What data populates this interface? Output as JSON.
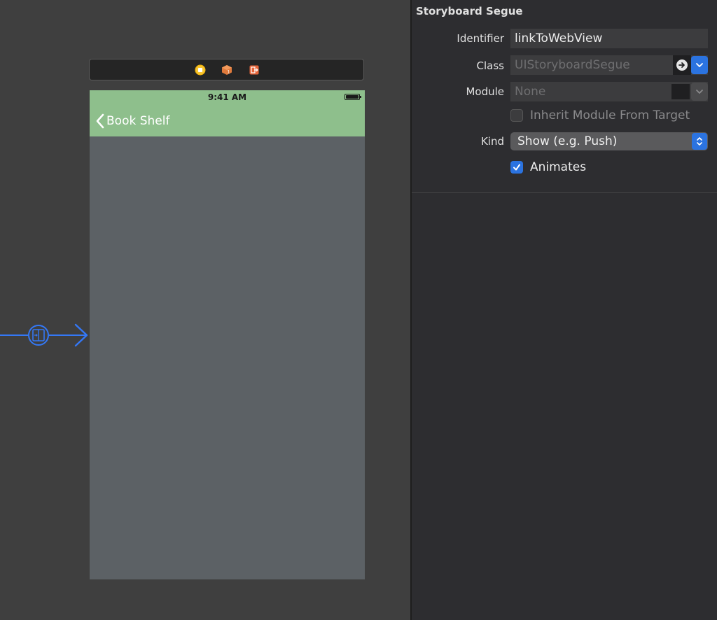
{
  "canvas": {
    "scene": {
      "status_time": "9:41 AM",
      "back_label": "Book Shelf"
    },
    "dock_icons": [
      "view-controller-icon",
      "first-responder-icon",
      "exit-icon"
    ],
    "entry_point_icon": "segue-show-icon"
  },
  "inspector": {
    "section_title": "Storyboard Segue",
    "identifier": {
      "label": "Identifier",
      "value": "linkToWebView"
    },
    "class": {
      "label": "Class",
      "placeholder": "UIStoryboardSegue"
    },
    "module": {
      "label": "Module",
      "placeholder": "None"
    },
    "inherit_module": {
      "label": "Inherit Module From Target",
      "checked": false
    },
    "kind": {
      "label": "Kind",
      "selected": "Show (e.g. Push)"
    },
    "animates": {
      "label": "Animates",
      "checked": true
    }
  },
  "colors": {
    "navbar": "#8ebf8c",
    "scene_bg": "#5c6165",
    "accent": "#2b73e0",
    "inspector_bg": "#2d2d30"
  }
}
